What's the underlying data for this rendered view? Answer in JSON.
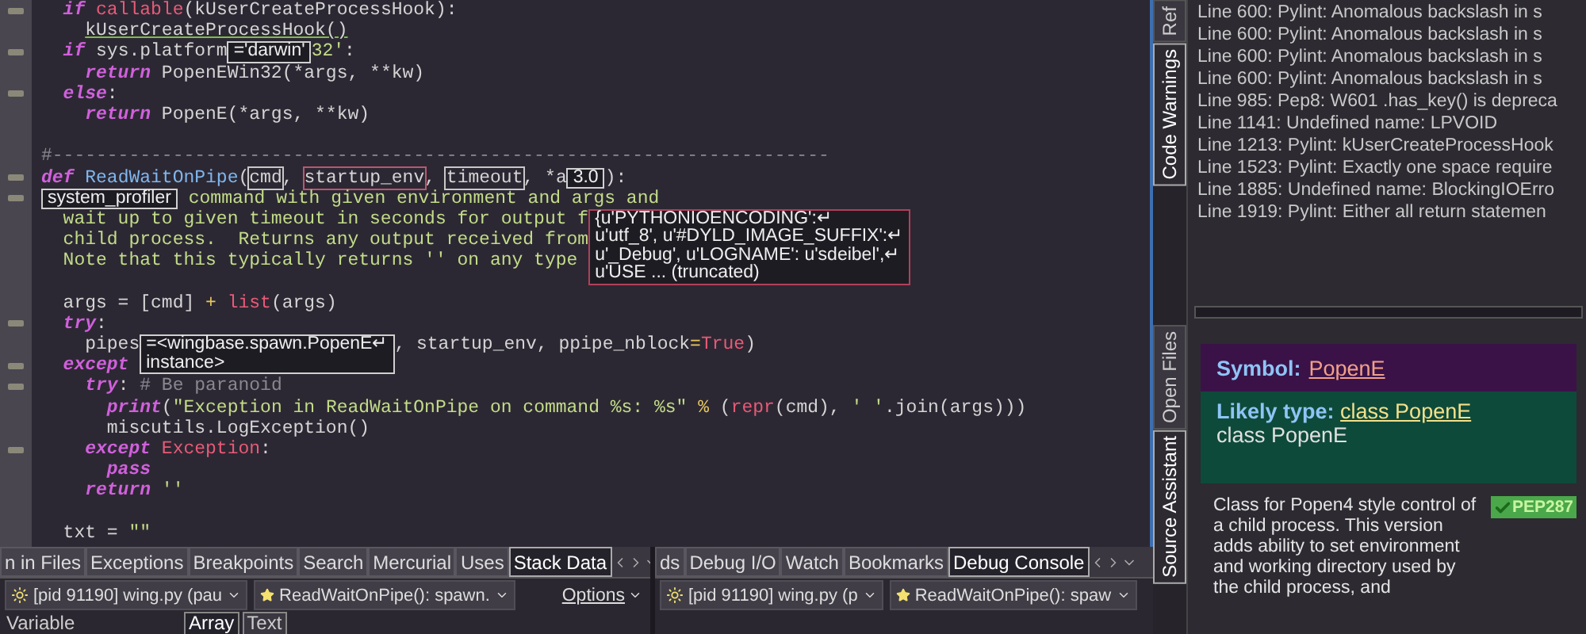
{
  "editor": {
    "lines": [
      {
        "foldable": true,
        "tokens": [
          {
            "kind": "kw",
            "text": "  if"
          },
          {
            "kind": "builtin",
            "text": " callable"
          },
          {
            "kind": "plain",
            "text": "(kUserCreateProcessHook):"
          }
        ]
      },
      {
        "foldable": false,
        "tokens": [
          {
            "kind": "warn",
            "text": "    kUserCreateProcessHook()"
          }
        ]
      },
      {
        "foldable": true,
        "tokens": [
          {
            "kind": "kw",
            "text": "  if"
          },
          {
            "kind": "plain",
            "text": " sys.platform"
          },
          {
            "kind": "tip",
            "lines": [
              "='darwin'"
            ],
            "color": "#d0d0d0"
          },
          {
            "kind": "str",
            "text": "32'"
          },
          {
            "kind": "plain",
            "text": ":"
          }
        ]
      },
      {
        "foldable": false,
        "tokens": [
          {
            "kind": "kw",
            "text": "    return"
          },
          {
            "kind": "plain",
            "text": " PopenEWin32(*args, **kw)"
          }
        ]
      },
      {
        "foldable": true,
        "tokens": [
          {
            "kind": "kw",
            "text": "  else"
          },
          {
            "kind": "plain",
            "text": ":"
          }
        ]
      },
      {
        "foldable": false,
        "tokens": [
          {
            "kind": "kw",
            "text": "    return"
          },
          {
            "kind": "plain",
            "text": " PopenE(*args, **kw)"
          }
        ]
      },
      {
        "foldable": false
      },
      {
        "foldable": false,
        "tokens": [
          {
            "kind": "comment",
            "text": "#-----------------------------------------------------------------------"
          }
        ]
      },
      {
        "foldable": true,
        "tokens": [
          {
            "kind": "kw",
            "text": "def"
          },
          {
            "kind": "defname",
            "text": " ReadWaitOnPipe"
          },
          {
            "kind": "plain",
            "text": "("
          },
          {
            "kind": "param",
            "text": "cmd",
            "color": "#c8c8c8"
          },
          {
            "kind": "plain",
            "text": ", "
          },
          {
            "kind": "param",
            "text": "startup_env",
            "color": "#b85870"
          },
          {
            "kind": "plain",
            "text": ", "
          },
          {
            "kind": "param",
            "text": "timeout",
            "color": "#c8c8c8"
          },
          {
            "kind": "plain",
            "text": ", *a"
          },
          {
            "kind": "tip",
            "lines": [
              "3.0"
            ],
            "color": "#d0d0d0"
          },
          {
            "kind": "plain",
            "text": "):"
          }
        ]
      },
      {
        "foldable": true,
        "tokens": [
          {
            "kind": "tip",
            "lines": [
              "system_profiler"
            ],
            "color": "#d0d0d0"
          },
          {
            "kind": "str",
            "text": " command with given environment and args and"
          }
        ]
      },
      {
        "foldable": false,
        "tokens": [
          {
            "kind": "str",
            "text": "  wait up to given timeout in seconds for output f"
          },
          {
            "kind": "tip",
            "lines": [
              "{u'PYTHONIOENCODING':↵",
              "u'utf_8', u'#DYLD_IMAGE_SUFFIX':↵",
              "u'_Debug', u'LOGNAME': u'sdeibel',↵",
              "u'USE ... (truncated)"
            ],
            "color": "#b0405a"
          }
        ]
      },
      {
        "foldable": false,
        "tokens": [
          {
            "kind": "str",
            "text": "  child process.  Returns any output received from"
          }
        ]
      },
      {
        "foldable": false,
        "tokens": [
          {
            "kind": "str",
            "text": "  Note that this typically returns '' on any type"
          }
        ]
      },
      {
        "foldable": false
      },
      {
        "foldable": false,
        "tokens": [
          {
            "kind": "plain",
            "text": "  args = [cmd] "
          },
          {
            "kind": "op",
            "text": "+"
          },
          {
            "kind": "builtin",
            "text": " list"
          },
          {
            "kind": "plain",
            "text": "(args)"
          }
        ]
      },
      {
        "foldable": true,
        "tokens": [
          {
            "kind": "kw",
            "text": "  try"
          },
          {
            "kind": "plain",
            "text": ":"
          }
        ]
      },
      {
        "foldable": false,
        "tokens": [
          {
            "kind": "plain",
            "text": "    pipes"
          },
          {
            "kind": "tip",
            "lines": [
              "=<wingbase.spawn.PopenE↵",
              "instance>"
            ],
            "color": "#d0d0d0"
          },
          {
            "kind": "plain",
            "text": ", startup_env, ppipe_nblock"
          },
          {
            "kind": "op",
            "text": "="
          },
          {
            "kind": "builtin",
            "text": "True"
          },
          {
            "kind": "plain",
            "text": ")"
          }
        ]
      },
      {
        "foldable": true,
        "tokens": [
          {
            "kind": "kw",
            "text": "  except"
          }
        ]
      },
      {
        "foldable": true,
        "tokens": [
          {
            "kind": "kw",
            "text": "    try"
          },
          {
            "kind": "plain",
            "text": ": "
          },
          {
            "kind": "comment",
            "text": "# Be paranoid"
          }
        ]
      },
      {
        "foldable": false,
        "tokens": [
          {
            "kind": "kw",
            "text": "      print"
          },
          {
            "kind": "plain",
            "text": "("
          },
          {
            "kind": "str",
            "text": "\"Exception in ReadWaitOnPipe on command %s: %s\""
          },
          {
            "kind": "op",
            "text": " %"
          },
          {
            "kind": "plain",
            "text": " ("
          },
          {
            "kind": "builtin",
            "text": "repr"
          },
          {
            "kind": "plain",
            "text": "(cmd), "
          },
          {
            "kind": "str",
            "text": "' '"
          },
          {
            "kind": "plain",
            "text": ".join(args)))"
          }
        ]
      },
      {
        "foldable": false,
        "tokens": [
          {
            "kind": "plain",
            "text": "      miscutils.LogException()"
          }
        ]
      },
      {
        "foldable": true,
        "tokens": [
          {
            "kind": "kw",
            "text": "    except"
          },
          {
            "kind": "builtin",
            "text": " Exception"
          },
          {
            "kind": "plain",
            "text": ":"
          }
        ]
      },
      {
        "foldable": false,
        "tokens": [
          {
            "kind": "kw",
            "text": "      pass"
          }
        ]
      },
      {
        "foldable": false,
        "tokens": [
          {
            "kind": "kw",
            "text": "    return"
          },
          {
            "kind": "str",
            "text": " ''"
          }
        ]
      },
      {
        "foldable": false
      },
      {
        "foldable": false,
        "tokens": [
          {
            "kind": "plain",
            "text": "  txt = "
          },
          {
            "kind": "str",
            "text": "\"\""
          }
        ]
      }
    ]
  },
  "bottom_panels": [
    {
      "tabs": [
        {
          "label": "n in Files",
          "selected": false
        },
        {
          "label": "Exceptions",
          "selected": false
        },
        {
          "label": "Breakpoints",
          "selected": false
        },
        {
          "label": "Search",
          "selected": false
        },
        {
          "label": "Mercurial",
          "selected": false
        },
        {
          "label": "Uses",
          "selected": false
        },
        {
          "label": "Stack Data",
          "selected": true
        }
      ],
      "selectors": [
        {
          "kind": "process",
          "label": "[pid 91190] wing.py (pau"
        },
        {
          "kind": "frame",
          "label": "ReadWaitOnPipe(): spawn."
        }
      ],
      "options_menu": "Options",
      "variable_header": "Variable",
      "view_tabs": [
        {
          "label": "Array",
          "selected": true
        },
        {
          "label": "Text",
          "selected": false
        }
      ]
    },
    {
      "tabs": [
        {
          "label": "ds",
          "selected": false
        },
        {
          "label": "Debug I/O",
          "selected": false
        },
        {
          "label": "Watch",
          "selected": false
        },
        {
          "label": "Bookmarks",
          "selected": false
        },
        {
          "label": "Debug Console",
          "selected": true
        }
      ],
      "selectors": [
        {
          "kind": "process",
          "label": "[pid 91190] wing.py (p"
        },
        {
          "kind": "frame",
          "label": "ReadWaitOnPipe(): spaw"
        }
      ]
    }
  ],
  "side_tabs_top": [
    {
      "label": "Ref",
      "selected": false
    },
    {
      "label": "Code Warnings",
      "selected": true
    }
  ],
  "code_warnings": [
    "Line 600: Pylint: Anomalous backslash in s",
    "Line 600: Pylint: Anomalous backslash in s",
    "Line 600: Pylint: Anomalous backslash in s",
    "Line 600: Pylint: Anomalous backslash in s",
    "Line 985: Pep8: W601 .has_key() is depreca",
    "Line 1141: Undefined name: LPVOID",
    "Line 1213: Pylint: kUserCreateProcessHook",
    "Line 1523: Pylint: Exactly one space require",
    "Line 1885: Undefined name: BlockingIOErro",
    "Line 1919: Pylint: Either all return statemen"
  ],
  "side_tabs_bottom": [
    {
      "label": "Open Files",
      "selected": false
    },
    {
      "label": "Source Assistant",
      "selected": true
    }
  ],
  "source_assistant": {
    "symbol_label": "Symbol:",
    "symbol": "PopenE",
    "likely_type_label": "Likely type:",
    "likely_type": "class PopenE",
    "type_text": "class PopenE",
    "badge": "PEP287",
    "description": "Class for Popen4 style control of a child process. This version adds ability to set environment and working directory used by the child process, and"
  }
}
